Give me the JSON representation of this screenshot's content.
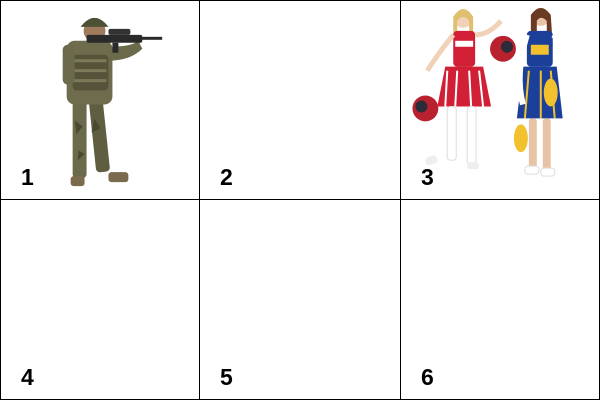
{
  "grid": {
    "cells": [
      {
        "number": "1",
        "image": "soldier-with-rifle"
      },
      {
        "number": "2",
        "image": ""
      },
      {
        "number": "3",
        "image": "two-women-in-cheerleader-costumes"
      },
      {
        "number": "4",
        "image": ""
      },
      {
        "number": "5",
        "image": ""
      },
      {
        "number": "6",
        "image": ""
      }
    ]
  },
  "colors": {
    "border": "#000000",
    "background": "#ffffff",
    "camo": "#6b6a4a",
    "red_uniform": "#d11f35",
    "blue_uniform": "#1c3f9a",
    "gold_accent": "#f2c12e"
  }
}
